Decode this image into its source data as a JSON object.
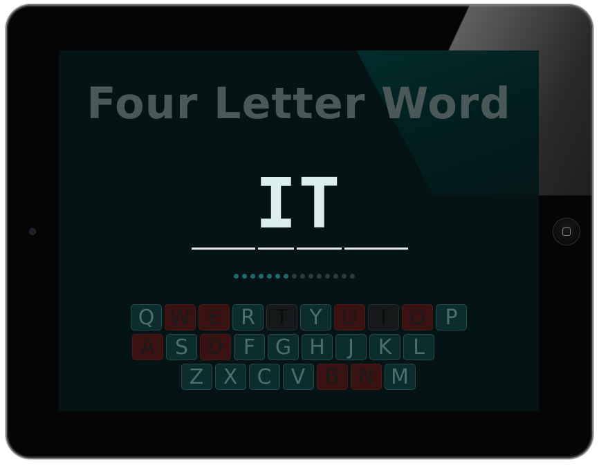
{
  "title": "Four Letter Word",
  "word_slots": [
    "",
    "I",
    "T",
    ""
  ],
  "progress": {
    "filled": 7,
    "total": 15
  },
  "keyboard": {
    "rows": [
      [
        {
          "label": "Q",
          "state": "available"
        },
        {
          "label": "W",
          "state": "wrong"
        },
        {
          "label": "E",
          "state": "wrong"
        },
        {
          "label": "R",
          "state": "available"
        },
        {
          "label": "T",
          "state": "used"
        },
        {
          "label": "Y",
          "state": "available"
        },
        {
          "label": "U",
          "state": "wrong"
        },
        {
          "label": "I",
          "state": "used"
        },
        {
          "label": "O",
          "state": "wrong"
        },
        {
          "label": "P",
          "state": "available"
        }
      ],
      [
        {
          "label": "A",
          "state": "wrong"
        },
        {
          "label": "S",
          "state": "available"
        },
        {
          "label": "D",
          "state": "wrong"
        },
        {
          "label": "F",
          "state": "available"
        },
        {
          "label": "G",
          "state": "available"
        },
        {
          "label": "H",
          "state": "available"
        },
        {
          "label": "J",
          "state": "available"
        },
        {
          "label": "K",
          "state": "available"
        },
        {
          "label": "L",
          "state": "available"
        }
      ],
      [
        {
          "label": "Z",
          "state": "available"
        },
        {
          "label": "X",
          "state": "available"
        },
        {
          "label": "C",
          "state": "available"
        },
        {
          "label": "V",
          "state": "available"
        },
        {
          "label": "B",
          "state": "wrong"
        },
        {
          "label": "N",
          "state": "wrong"
        },
        {
          "label": "M",
          "state": "available"
        }
      ]
    ]
  },
  "colors": {
    "title": "#4a5857",
    "key_available": "#0b2d2e",
    "key_wrong": "#3a1212",
    "key_used": "#151919",
    "progress_on": "#1d6b6a",
    "progress_off": "#2f3a3a"
  },
  "icons": {
    "home_button": "home-button-icon",
    "camera": "camera-icon"
  }
}
